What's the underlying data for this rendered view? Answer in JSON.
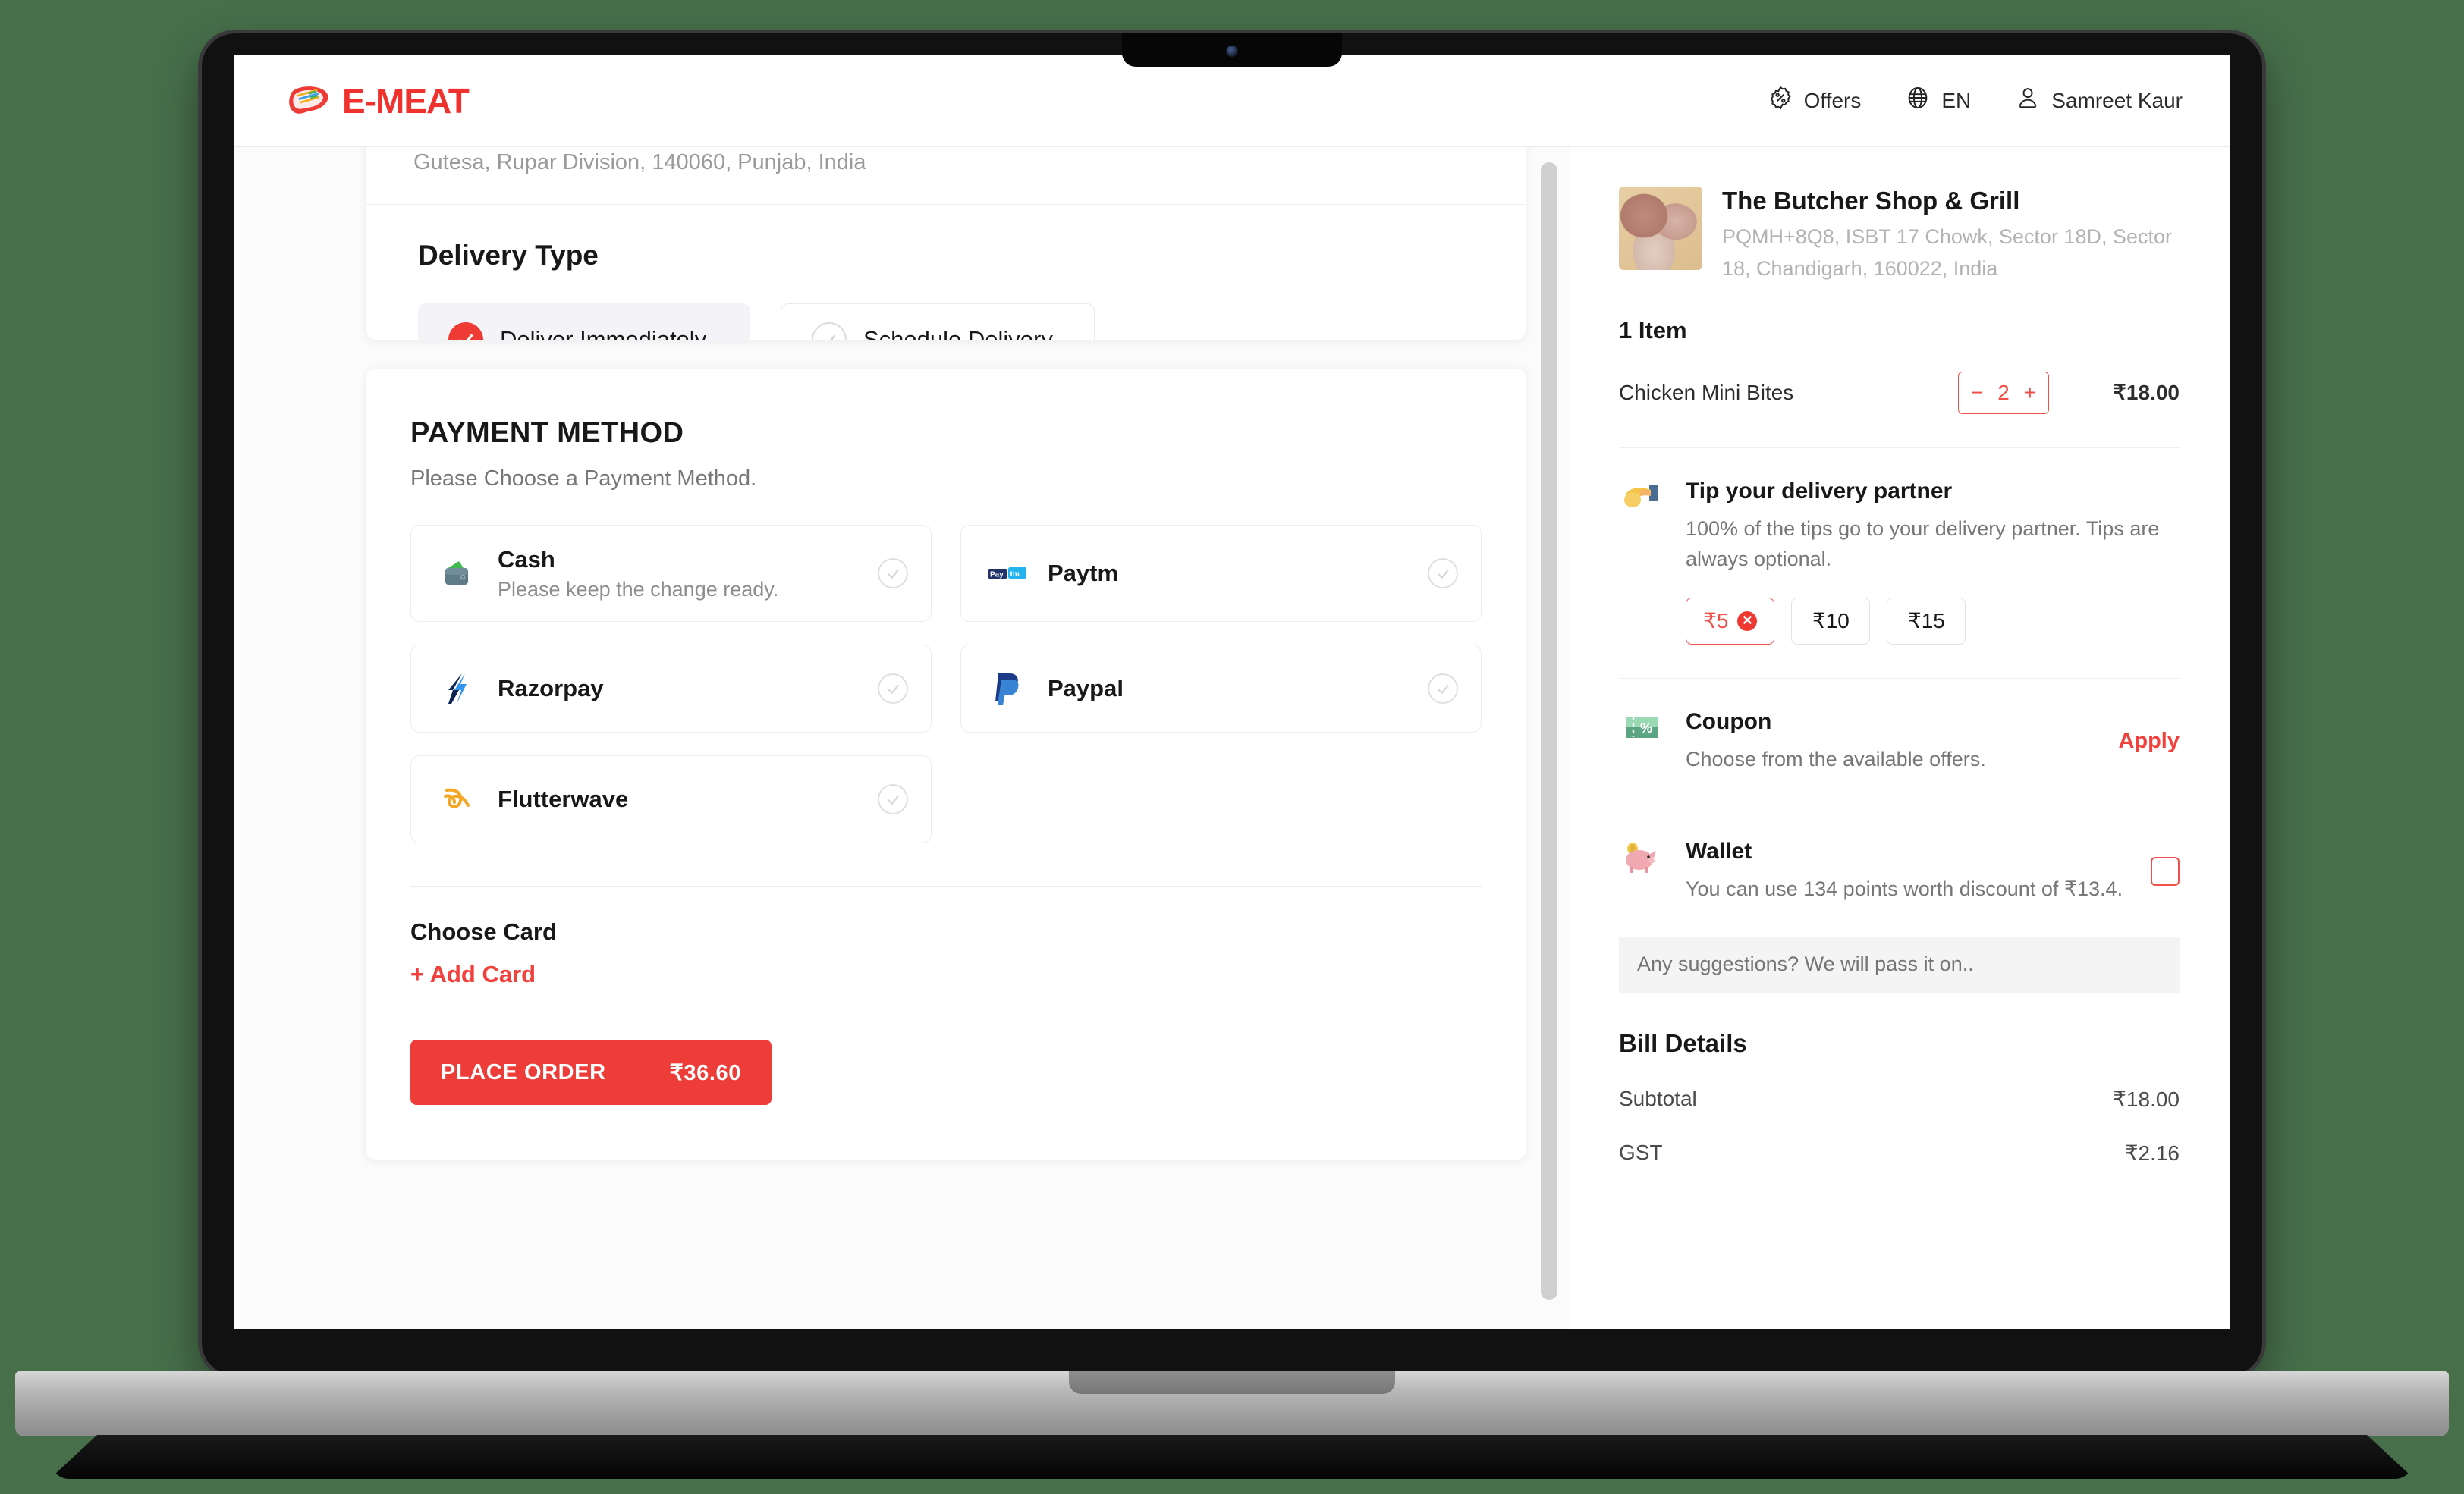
{
  "header": {
    "brand": "E-MEAT",
    "brand_icon": "steak-logo-icon",
    "offers_label": "Offers",
    "offers_icon": "percent-badge-icon",
    "language_label": "EN",
    "language_icon": "globe-icon",
    "user_name": "Samreet Kaur",
    "user_icon": "person-icon"
  },
  "checkout": {
    "address_fragment": "Gutesa, Rupar Division, 140060, Punjab, India",
    "delivery": {
      "title": "Delivery Type",
      "options": [
        {
          "label": "Deliver Immediately",
          "selected": true
        },
        {
          "label": "Schedule Delivery",
          "selected": false
        }
      ]
    },
    "payment": {
      "heading": "PAYMENT METHOD",
      "subheading": "Please Choose a Payment Method.",
      "methods": [
        {
          "label": "Cash",
          "sub": "Please keep the change ready.",
          "icon": "wallet-icon"
        },
        {
          "label": "Paytm",
          "sub": "",
          "icon": "paytm-icon"
        },
        {
          "label": "Razorpay",
          "sub": "",
          "icon": "razorpay-icon"
        },
        {
          "label": "Paypal",
          "sub": "",
          "icon": "paypal-icon"
        },
        {
          "label": "Flutterwave",
          "sub": "",
          "icon": "flutterwave-icon"
        }
      ],
      "choose_card_label": "Choose Card",
      "add_card_label": "+ Add Card",
      "place_order_label": "PLACE ORDER",
      "place_order_amount": "₹36.60"
    }
  },
  "summary": {
    "store_name": "The Butcher Shop & Grill",
    "store_address": "PQMH+8Q8, ISBT 17 Chowk, Sector 18D, Sector 18, Chandigarh, 160022, India",
    "item_count_label": "1 Item",
    "items": [
      {
        "name": "Chicken Mini Bites",
        "qty": "2",
        "price": "₹18.00",
        "minus": "−",
        "plus": "+"
      }
    ],
    "tip": {
      "icon": "hand-holding-money-icon",
      "title": "Tip your delivery partner",
      "desc": "100% of the tips go to your delivery partner. Tips are always optional.",
      "options": [
        {
          "label": "₹5",
          "selected": true,
          "clear_icon": "remove-circle-icon"
        },
        {
          "label": "₹10",
          "selected": false
        },
        {
          "label": "₹15",
          "selected": false
        }
      ]
    },
    "coupon": {
      "icon": "coupon-percent-icon",
      "title": "Coupon",
      "desc": "Choose from the available offers.",
      "action_label": "Apply"
    },
    "wallet": {
      "icon": "piggy-bank-icon",
      "title": "Wallet",
      "desc": "You can use 134 points worth discount of ₹13.4.",
      "checked": false
    },
    "suggestion_placeholder": "Any suggestions? We will pass it on..",
    "bill": {
      "title": "Bill Details",
      "rows": [
        {
          "label": "Subtotal",
          "value": "₹18.00"
        },
        {
          "label": "GST",
          "value": "₹2.16"
        }
      ]
    }
  },
  "colors": {
    "brand_red": "#ef3b36",
    "page_background": "#476f4a",
    "accent_link": "#f2413c"
  }
}
